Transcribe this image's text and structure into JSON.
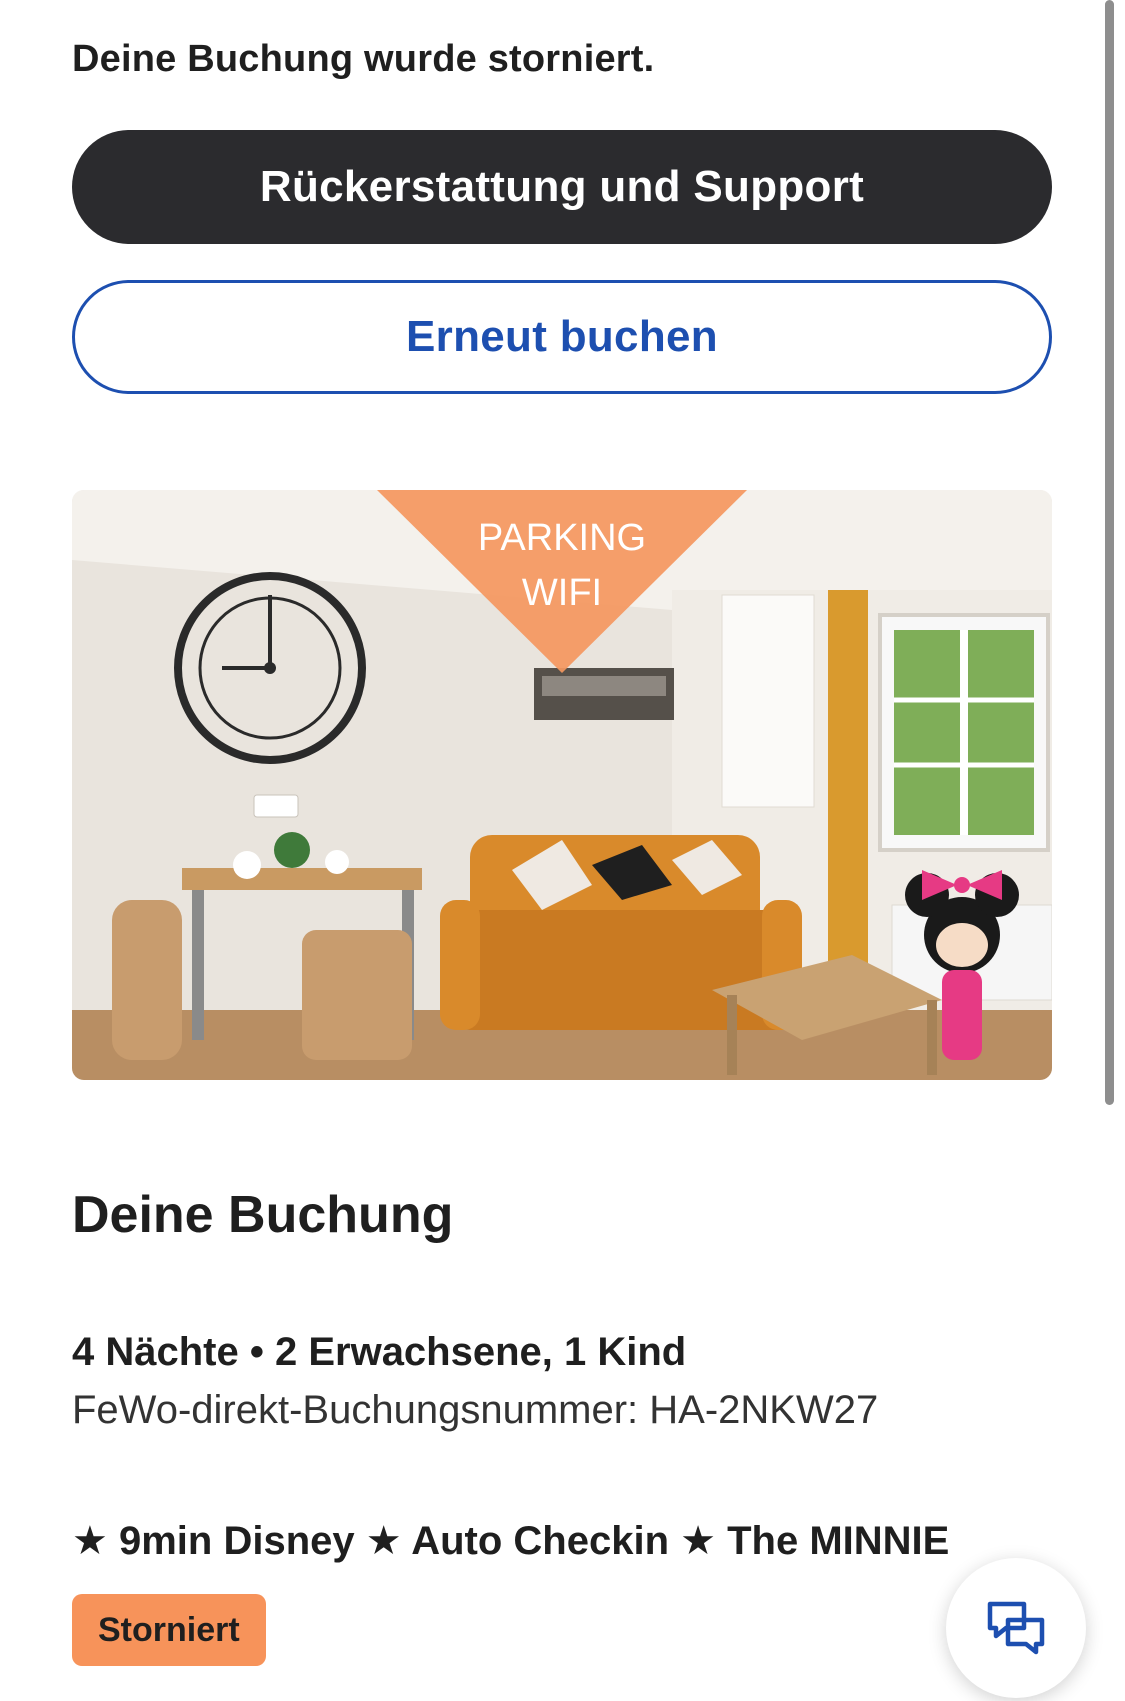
{
  "status_message": "Deine Buchung wurde storniert.",
  "buttons": {
    "refund_support": "Rückerstattung und Support",
    "rebook": "Erneut buchen"
  },
  "photo": {
    "overlay_lines": [
      "PARKING",
      "WIFI"
    ]
  },
  "booking": {
    "section_title": "Deine Buchung",
    "summary": "4 Nächte • 2 Erwachsene, 1 Kind",
    "booking_number": "FeWo-direkt-Buchungsnummer: HA-2NKW27",
    "listing_name": "★ 9min Disney ★ Auto Checkin ★ The MINNIE",
    "status_badge": "Storniert"
  },
  "colors": {
    "primary_button_bg": "#2b2b2e",
    "secondary_button_text": "#1d4fb0",
    "badge_bg": "#f7935a",
    "sofa": "#d98a2b",
    "overlay_orange": "#f4975e"
  },
  "icons": {
    "chat": "chat-bubbles-icon"
  }
}
